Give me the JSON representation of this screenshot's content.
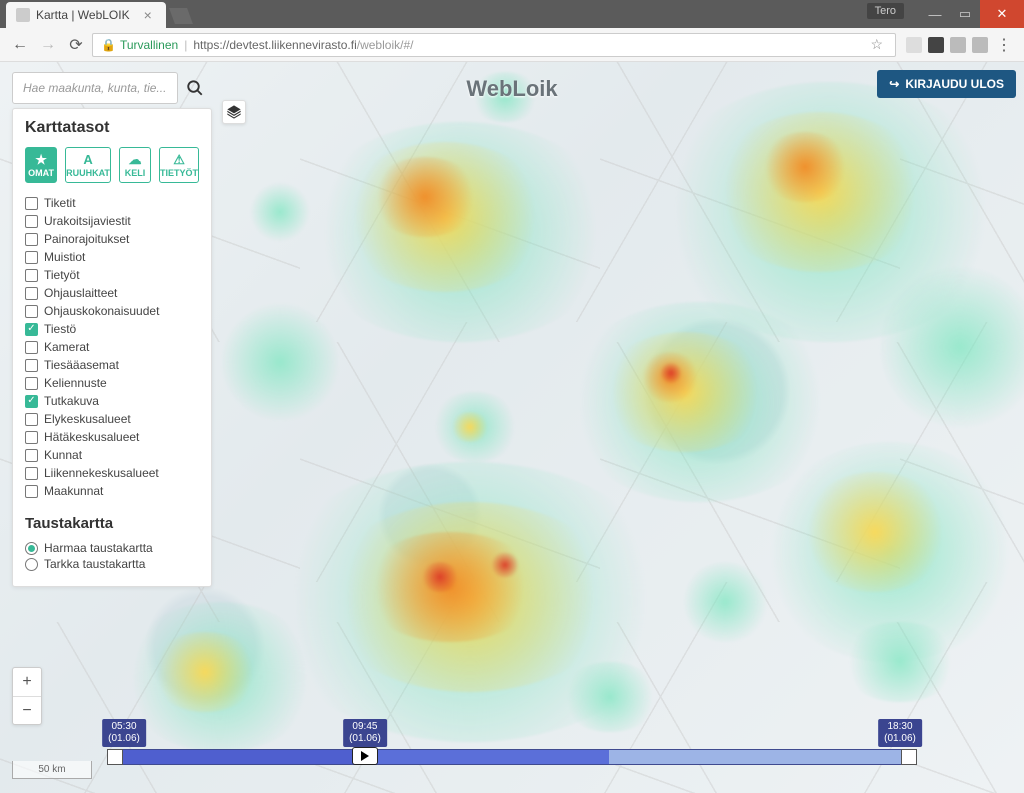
{
  "window": {
    "user_label": "Tero",
    "tab_title": "Kartta | WebLOIK"
  },
  "browser": {
    "secure_label": "Turvallinen",
    "url_host": "https://devtest.liikennevirasto.fi",
    "url_path": "/webloik/#/"
  },
  "app": {
    "title": "WebLoik",
    "logout_label": "KIRJAUDU ULOS"
  },
  "search": {
    "placeholder": "Hae maakunta, kunta, tie..."
  },
  "panel": {
    "title": "Karttatasot",
    "categories": [
      {
        "label": "OMAT",
        "icon": "★",
        "active": true
      },
      {
        "label": "RUUHKAT",
        "icon": "A",
        "active": false
      },
      {
        "label": "KELI",
        "icon": "☁",
        "active": false
      },
      {
        "label": "TIETYÖT",
        "icon": "⚠",
        "active": false
      }
    ],
    "layers": [
      {
        "label": "Tiketit",
        "checked": false
      },
      {
        "label": "Urakoitsijaviestit",
        "checked": false
      },
      {
        "label": "Painorajoitukset",
        "checked": false
      },
      {
        "label": "Muistiot",
        "checked": false
      },
      {
        "label": "Tietyöt",
        "checked": false
      },
      {
        "label": "Ohjauslaitteet",
        "checked": false
      },
      {
        "label": "Ohjauskokonaisuudet",
        "checked": false
      },
      {
        "label": "Tiestö",
        "checked": true
      },
      {
        "label": "Kamerat",
        "checked": false
      },
      {
        "label": "Tiesääasemat",
        "checked": false
      },
      {
        "label": "Keliennuste",
        "checked": false
      },
      {
        "label": "Tutkakuva",
        "checked": true
      },
      {
        "label": "Elykeskusalueet",
        "checked": false
      },
      {
        "label": "Hätäkeskusalueet",
        "checked": false
      },
      {
        "label": "Kunnat",
        "checked": false
      },
      {
        "label": "Liikennekeskusalueet",
        "checked": false
      },
      {
        "label": "Maakunnat",
        "checked": false
      }
    ],
    "basemap_title": "Taustakartta",
    "basemaps": [
      {
        "label": "Harmaa taustakartta",
        "checked": true
      },
      {
        "label": "Tarkka taustakartta",
        "checked": false
      }
    ]
  },
  "scale": {
    "label": "50 km"
  },
  "timeline": {
    "start": {
      "time": "05:30",
      "date": "(01.06)"
    },
    "current": {
      "time": "09:45",
      "date": "(01.06)"
    },
    "end": {
      "time": "18:30",
      "date": "(01.06)"
    }
  }
}
